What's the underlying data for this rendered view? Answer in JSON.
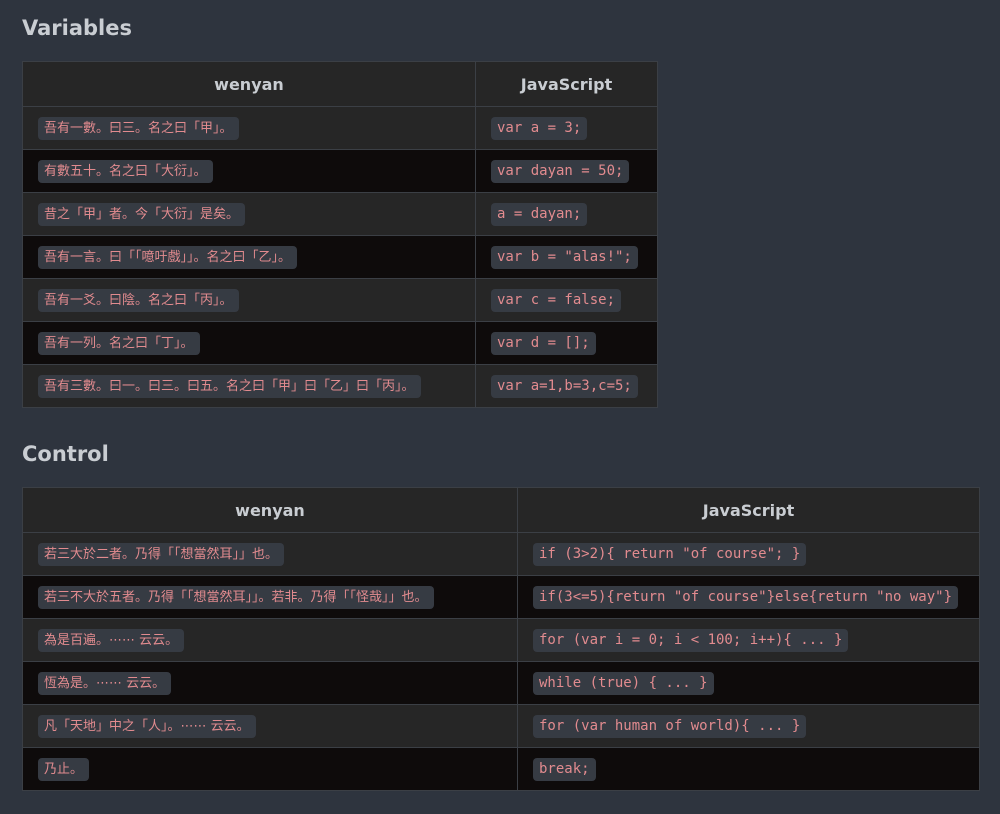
{
  "sections": [
    {
      "title": "Variables",
      "headers": [
        "wenyan",
        "JavaScript"
      ],
      "rows": [
        [
          "吾有一數。曰三。名之曰「甲」。",
          "var a = 3;"
        ],
        [
          "有數五十。名之曰「大衍」。",
          "var dayan = 50;"
        ],
        [
          "昔之「甲」者。今「大衍」是矣。",
          "a = dayan;"
        ],
        [
          "吾有一言。曰「「噫吁戲」」。名之曰「乙」。",
          "var b = \"alas!\";"
        ],
        [
          "吾有一爻。曰陰。名之曰「丙」。",
          "var c = false;"
        ],
        [
          "吾有一列。名之曰「丁」。",
          "var d = [];"
        ],
        [
          "吾有三數。曰一。曰三。曰五。名之曰「甲」曰「乙」曰「丙」。",
          "var a=1,b=3,c=5;"
        ]
      ]
    },
    {
      "title": "Control",
      "headers": [
        "wenyan",
        "JavaScript"
      ],
      "rows": [
        [
          "若三大於二者。乃得「「想當然耳」」也。",
          "if (3>2){ return \"of course\"; }"
        ],
        [
          "若三不大於五者。乃得「「想當然耳」」。若非。乃得「「怪哉」」也。",
          "if(3<=5){return \"of course\"}else{return \"no way\"}"
        ],
        [
          "為是百遍。⋯⋯ 云云。",
          "for (var i = 0; i < 100; i++){ ... }"
        ],
        [
          "恆為是。⋯⋯ 云云。",
          "while (true) { ... }"
        ],
        [
          "凡「天地」中之「人」。⋯⋯ 云云。",
          "for (var human of world){ ... }"
        ],
        [
          "乃止。",
          "break;"
        ]
      ]
    }
  ]
}
